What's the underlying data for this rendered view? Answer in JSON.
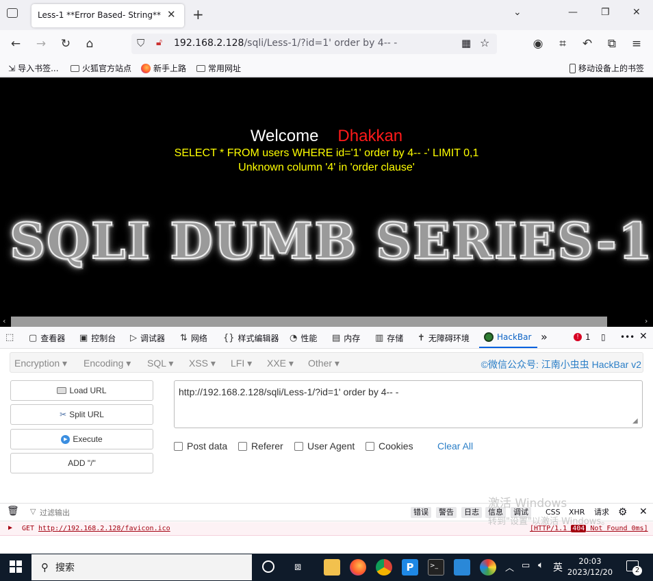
{
  "browser": {
    "tab_title": "Less-1 **Error Based- String**",
    "url_host": "192.168.2.128",
    "url_rest": "/sqli/Less-1/?id=1' order by 4-- -",
    "bookmarks": [
      "导入书签...",
      "火狐官方站点",
      "新手上路",
      "常用网址"
    ],
    "mobile_bookmarks": "移动设备上的书签"
  },
  "page": {
    "welcome": "Welcome",
    "name": "Dhakkan",
    "query": "SELECT * FROM users WHERE id='1' order by 4-- -' LIMIT 0,1",
    "error": "Unknown column '4' in 'order clause'",
    "banner": "SQLI DUMB SERIES-1",
    "accent_red": "#ff1a1a",
    "accent_yellow": "#ffff00"
  },
  "devtools": {
    "tabs": [
      "查看器",
      "控制台",
      "调试器",
      "网络",
      "样式编辑器",
      "性能",
      "内存",
      "存储",
      "无障碍环境",
      "HackBar"
    ],
    "error_count": "1"
  },
  "hackbar": {
    "menu": [
      "Encryption",
      "Encoding",
      "SQL",
      "XSS",
      "LFI",
      "XXE",
      "Other"
    ],
    "credit": "©微信公众号: 江南小虫虫 HackBar v2",
    "buttons": [
      "Load URL",
      "Split URL",
      "Execute",
      "ADD \"/\""
    ],
    "url_value": "http://192.168.2.128/sqli/Less-1/?id=1' order by 4-- -",
    "checkboxes": [
      "Post data",
      "Referer",
      "User Agent",
      "Cookies"
    ],
    "clear_all": "Clear All"
  },
  "console": {
    "filter_placeholder": "过滤输出",
    "filters": [
      "错误",
      "警告",
      "日志",
      "信息",
      "调试",
      "CSS",
      "XHR",
      "请求"
    ],
    "log_method": "GET",
    "log_url": "http://192.168.2.128/favicon.ico",
    "log_status_prefix": "[HTTP/1.1",
    "log_status_code": "404",
    "log_status_suffix": "Not Found 0ms]"
  },
  "watermark": {
    "line1": "激活 Windows",
    "line2": "转到\"设置\"以激活 Windows。"
  },
  "taskbar": {
    "search": "搜索",
    "ime": "英",
    "time": "20:03",
    "date": "2023/12/20",
    "notifications": "2"
  }
}
